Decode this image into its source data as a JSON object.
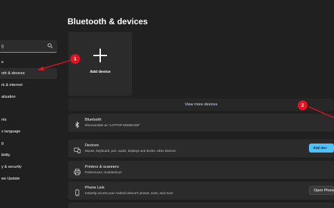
{
  "colors": {
    "accent": "#4cc2ff",
    "annotation": "#e81123",
    "background": "#202020",
    "card": "#2b2b2b"
  },
  "sidebar": {
    "search_value": "g",
    "search_icon": "search-icon",
    "items": [
      {
        "label": "e",
        "active": false
      },
      {
        "label": "oth & devices",
        "active": true
      },
      {
        "label": "rk & internet",
        "active": false
      },
      {
        "label": "alization",
        "active": false
      },
      {
        "label": "nts",
        "active": false
      },
      {
        "label": "s language",
        "active": false
      },
      {
        "label": "g",
        "active": false
      },
      {
        "label": "ibility",
        "active": false
      },
      {
        "label": "y & security",
        "active": false
      },
      {
        "label": "ws Update",
        "active": false
      }
    ]
  },
  "header": {
    "title": "Bluetooth & devices"
  },
  "add_device": {
    "label": "Add device",
    "icon": "plus-icon"
  },
  "view_more": {
    "label": "View more devices"
  },
  "bluetooth": {
    "title": "Bluetooth",
    "subtitle": "Discoverable as \"LAPTOP-6D66K52B\"",
    "icon": "bluetooth-icon"
  },
  "devices": {
    "title": "Devices",
    "subtitle": "Mouse, keyboard, pen, audio, displays and docks, other devices",
    "button": "Add dev",
    "icon": "devices-icon"
  },
  "printers": {
    "title": "Printers & scanners",
    "subtitle": "Preferences, troubleshoot",
    "icon": "printer-icon"
  },
  "phone_link": {
    "title": "Phone Link",
    "subtitle": "Instantly access your Android device's photos, texts, and more",
    "button": "Open Phone",
    "icon": "phone-icon"
  },
  "annotations": {
    "one": "1",
    "two": "2"
  }
}
